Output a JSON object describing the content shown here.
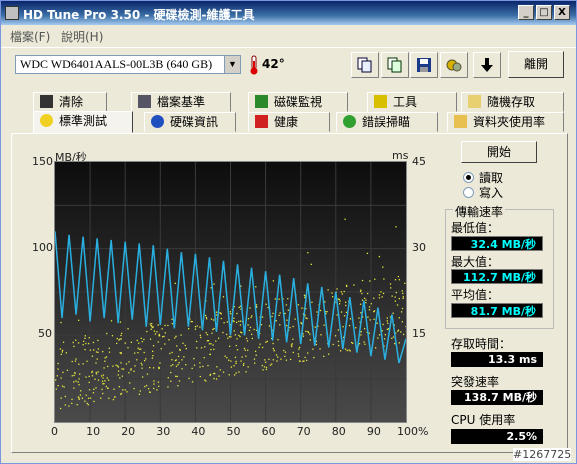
{
  "window": {
    "title": "HD Tune Pro 3.50 - 硬碟檢測-維護工具",
    "minimize": "_",
    "maximize": "□",
    "close": "X"
  },
  "menu": {
    "file": "檔案(F)",
    "help": "說明(H)"
  },
  "toolbar": {
    "drive": "WDC WD6401AALS-00L3B (640 GB)",
    "temperature": "42°",
    "exit": "離開"
  },
  "tabs_top": [
    {
      "label": "清除",
      "icon": "trash-icon"
    },
    {
      "label": "檔案基準",
      "icon": "file-benchmark-icon"
    },
    {
      "label": "磁碟監視",
      "icon": "monitor-icon"
    },
    {
      "label": "工具",
      "icon": "speaker-icon"
    },
    {
      "label": "隨機存取",
      "icon": "random-access-icon"
    }
  ],
  "tabs_bottom": [
    {
      "label": "標準測試",
      "icon": "lightbulb-icon"
    },
    {
      "label": "硬碟資訊",
      "icon": "info-icon"
    },
    {
      "label": "健康",
      "icon": "health-cross-icon"
    },
    {
      "label": "錯誤掃瞄",
      "icon": "magnifier-icon"
    },
    {
      "label": "資料夾使用率",
      "icon": "folder-icon"
    }
  ],
  "controls": {
    "start": "開始",
    "read": "讀取",
    "write": "寫入",
    "read_selected": true
  },
  "stats": {
    "transfer_group": "傳輸速率",
    "min_label": "最低值：",
    "min_value": "32.4 MB/秒",
    "max_label": "最大值：",
    "max_value": "112.7 MB/秒",
    "avg_label": "平均值：",
    "avg_value": "81.7 MB/秒",
    "access_label": "存取時間：",
    "access_value": "13.3 ms",
    "burst_label": "突發速率",
    "burst_value": "138.7 MB/秒",
    "cpu_label": "CPU 使用率",
    "cpu_value": "2.5%"
  },
  "watermark": "#1267725",
  "chart_data": {
    "type": "line",
    "left_axis_label": "MB/秒",
    "right_axis_label": "ms",
    "left_ticks": [
      "150",
      "100",
      "50"
    ],
    "right_ticks": [
      "45",
      "30",
      "15"
    ],
    "x_ticks": [
      "0",
      "10",
      "20",
      "30",
      "40",
      "50",
      "60",
      "70",
      "80",
      "90",
      "100%"
    ],
    "xlim": [
      0,
      100
    ],
    "ylim": [
      0,
      150
    ],
    "y2lim": [
      0,
      45
    ],
    "series": [
      {
        "color": "#2ab0e0",
        "values": [
          [
            0,
            110
          ],
          [
            2,
            60
          ],
          [
            4,
            108
          ],
          [
            6,
            62
          ],
          [
            8,
            107
          ],
          [
            10,
            58
          ],
          [
            12,
            106
          ],
          [
            14,
            60
          ],
          [
            16,
            105
          ],
          [
            18,
            57
          ],
          [
            20,
            104
          ],
          [
            22,
            59
          ],
          [
            24,
            103
          ],
          [
            26,
            55
          ],
          [
            28,
            102
          ],
          [
            30,
            56
          ],
          [
            32,
            100
          ],
          [
            34,
            54
          ],
          [
            36,
            98
          ],
          [
            38,
            55
          ],
          [
            40,
            97
          ],
          [
            42,
            53
          ],
          [
            44,
            95
          ],
          [
            46,
            52
          ],
          [
            48,
            93
          ],
          [
            50,
            50
          ],
          [
            52,
            91
          ],
          [
            54,
            50
          ],
          [
            56,
            89
          ],
          [
            58,
            48
          ],
          [
            60,
            87
          ],
          [
            62,
            47
          ],
          [
            64,
            85
          ],
          [
            66,
            46
          ],
          [
            68,
            83
          ],
          [
            70,
            45
          ],
          [
            72,
            80
          ],
          [
            74,
            44
          ],
          [
            76,
            78
          ],
          [
            78,
            43
          ],
          [
            80,
            75
          ],
          [
            82,
            42
          ],
          [
            84,
            72
          ],
          [
            86,
            40
          ],
          [
            88,
            70
          ],
          [
            90,
            38
          ],
          [
            92,
            66
          ],
          [
            94,
            36
          ],
          [
            96,
            62
          ],
          [
            98,
            34
          ],
          [
            100,
            48
          ]
        ]
      }
    ],
    "scatter": {
      "color": "#e8e840",
      "axis": "right"
    }
  }
}
